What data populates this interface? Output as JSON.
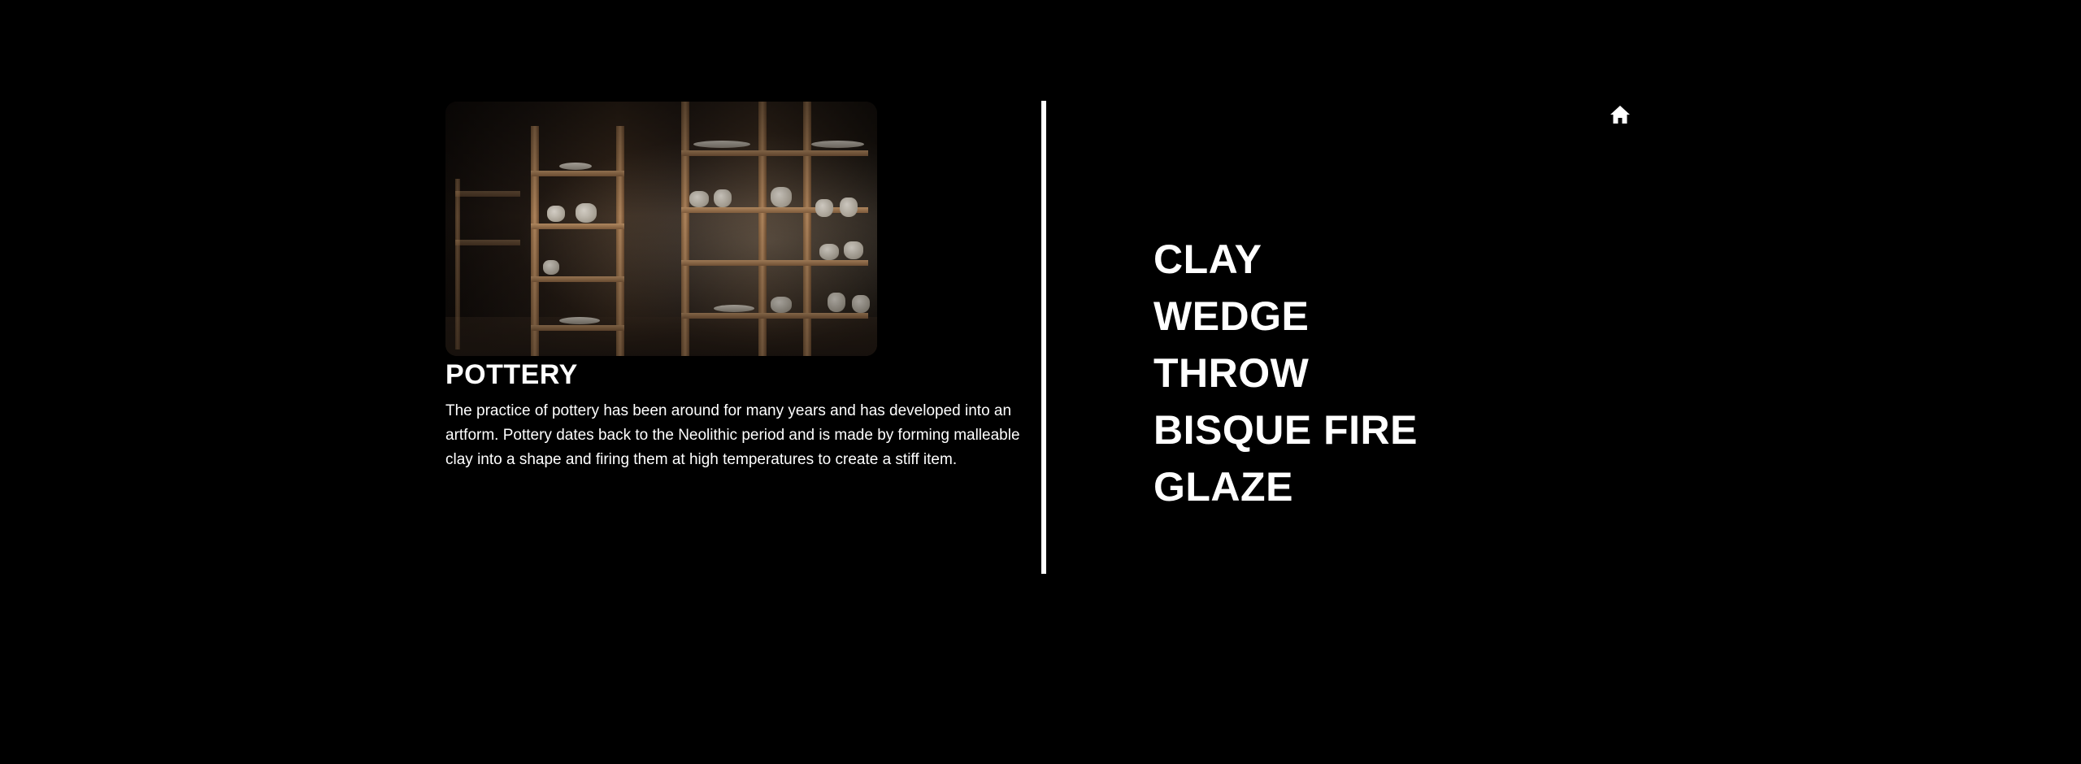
{
  "colors": {
    "background": "#000000",
    "text": "#ffffff",
    "divider": "#ffffff"
  },
  "card": {
    "image_alt": "Pottery studio shelves with ceramic pieces",
    "title": "POTTERY",
    "description": "The practice of pottery has been around for many years and has developed into an artform. Pottery dates back to the Neolithic period and is made by forming malleable clay into a shape and firing them at high temperatures to create a stiff item."
  },
  "nav": {
    "home_icon": "home-icon"
  },
  "steps": [
    {
      "label": "CLAY"
    },
    {
      "label": "WEDGE"
    },
    {
      "label": "THROW"
    },
    {
      "label": "BISQUE FIRE"
    },
    {
      "label": "GLAZE"
    }
  ]
}
